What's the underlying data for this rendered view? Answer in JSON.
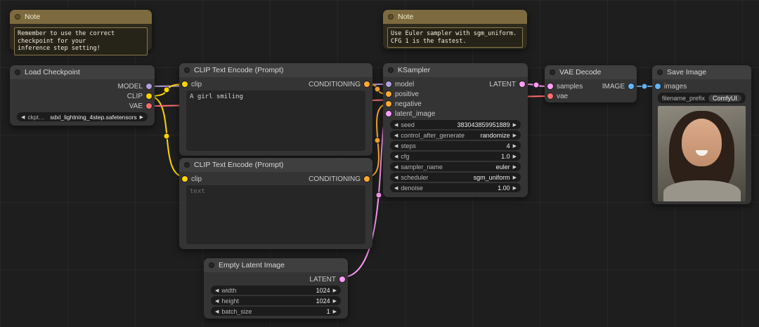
{
  "colors": {
    "model": "#B39DDB",
    "clip": "#FFD500",
    "vae": "#FF6E6E",
    "conditioning": "#FFA931",
    "latent": "#FF9CF9",
    "image": "#64B5F6"
  },
  "icons": {
    "arrow_left": "◀",
    "arrow_right": "▶"
  },
  "notes": {
    "checkpoint_note": {
      "title": "Note",
      "text": "Remember to use the correct checkpoint for your\ninference step setting!"
    },
    "sampler_note": {
      "title": "Note",
      "text": "Use Euler sampler with sgm_uniform.\nCFG 1 is the fastest."
    }
  },
  "load_checkpoint": {
    "title": "Load Checkpoint",
    "outputs": {
      "model": "MODEL",
      "clip": "CLIP",
      "vae": "VAE"
    },
    "widgets": [
      {
        "label": "ckpt_name",
        "value": "sdxl_lightning_4step.safetensors"
      }
    ]
  },
  "clip_positive": {
    "title": "CLIP Text Encode (Prompt)",
    "input": "clip",
    "output": "CONDITIONING",
    "text": "A girl smiling"
  },
  "clip_negative": {
    "title": "CLIP Text Encode (Prompt)",
    "input": "clip",
    "output": "CONDITIONING",
    "text": "text"
  },
  "empty_latent": {
    "title": "Empty Latent Image",
    "output": "LATENT",
    "widgets": [
      {
        "label": "width",
        "value": "1024"
      },
      {
        "label": "height",
        "value": "1024"
      },
      {
        "label": "batch_size",
        "value": "1"
      }
    ]
  },
  "ksampler": {
    "title": "KSampler",
    "inputs": [
      "model",
      "positive",
      "negative",
      "latent_image"
    ],
    "output": "LATENT",
    "widgets": [
      {
        "label": "seed",
        "value": "383043859951889"
      },
      {
        "label": "control_after_generate",
        "value": "randomize"
      },
      {
        "label": "steps",
        "value": "4"
      },
      {
        "label": "cfg",
        "value": "1.0"
      },
      {
        "label": "sampler_name",
        "value": "euler"
      },
      {
        "label": "scheduler",
        "value": "sgm_uniform"
      },
      {
        "label": "denoise",
        "value": "1.00"
      }
    ]
  },
  "vae_decode": {
    "title": "VAE Decode",
    "inputs": [
      "samples",
      "vae"
    ],
    "output": "IMAGE"
  },
  "save_image": {
    "title": "Save Image",
    "input": "images",
    "widgets": [
      {
        "label": "filename_prefix",
        "value": "ComfyUI"
      }
    ]
  },
  "links": [
    {
      "from": "LoadCheckpoint.MODEL",
      "to": "KSampler.model",
      "color": "model"
    },
    {
      "from": "LoadCheckpoint.CLIP",
      "to": "CLIPTextEncode(positive).clip",
      "color": "clip"
    },
    {
      "from": "LoadCheckpoint.CLIP",
      "to": "CLIPTextEncode(negative).clip",
      "color": "clip"
    },
    {
      "from": "LoadCheckpoint.VAE",
      "to": "VAEDecode.vae",
      "color": "vae"
    },
    {
      "from": "CLIPTextEncode(positive).CONDITIONING",
      "to": "KSampler.positive",
      "color": "conditioning"
    },
    {
      "from": "CLIPTextEncode(negative).CONDITIONING",
      "to": "KSampler.negative",
      "color": "conditioning"
    },
    {
      "from": "EmptyLatentImage.LATENT",
      "to": "KSampler.latent_image",
      "color": "latent"
    },
    {
      "from": "KSampler.LATENT",
      "to": "VAEDecode.samples",
      "color": "latent"
    },
    {
      "from": "VAEDecode.IMAGE",
      "to": "SaveImage.images",
      "color": "image"
    }
  ]
}
